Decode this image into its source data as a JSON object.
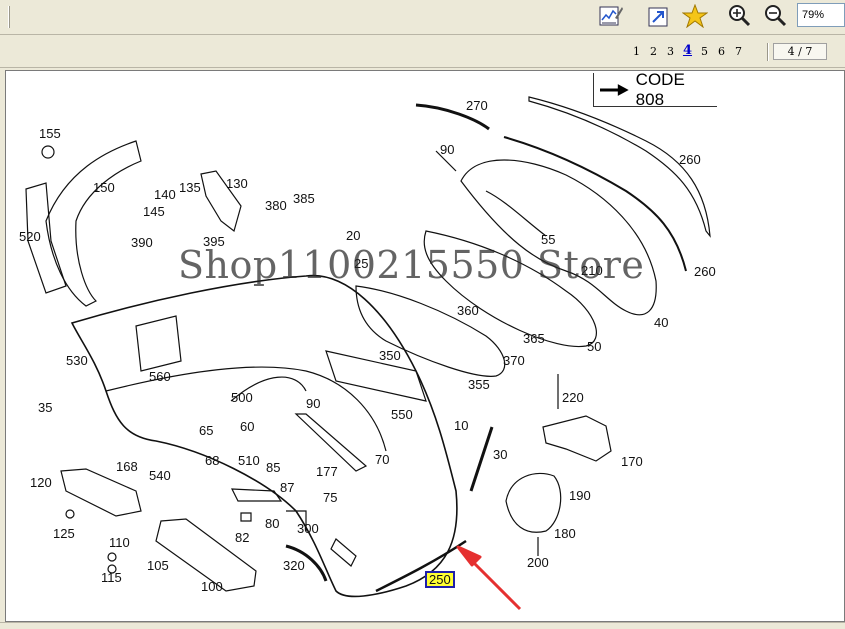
{
  "toolbar": {
    "zoom_value": "79%",
    "tools": [
      "chart-edit-icon",
      "fit-page-icon",
      "favorite-star-icon",
      "zoom-in-icon",
      "zoom-out-icon"
    ]
  },
  "pagination": {
    "pages": [
      "1",
      "2",
      "3",
      "4",
      "5",
      "6",
      "7"
    ],
    "current_page": "4",
    "indicator": "4 / 7"
  },
  "diagram": {
    "code_label": "CODE 808",
    "watermark": "Shop1100215550 Store",
    "highlighted_part": "250",
    "parts": [
      "270",
      "90",
      "260",
      "155",
      "150",
      "140",
      "135",
      "130",
      "145",
      "380",
      "385",
      "520",
      "390",
      "395",
      "20",
      "25",
      "55",
      "210",
      "260",
      "360",
      "365",
      "370",
      "50",
      "40",
      "530",
      "560",
      "350",
      "355",
      "35",
      "500",
      "90",
      "550",
      "10",
      "65",
      "60",
      "120",
      "168",
      "540",
      "68",
      "510",
      "85",
      "177",
      "70",
      "30",
      "220",
      "170",
      "125",
      "87",
      "75",
      "80",
      "300",
      "190",
      "180",
      "82",
      "110",
      "115",
      "105",
      "320",
      "100",
      "200"
    ],
    "accent_color": "#e53030",
    "highlight_color": "#ffff33"
  }
}
